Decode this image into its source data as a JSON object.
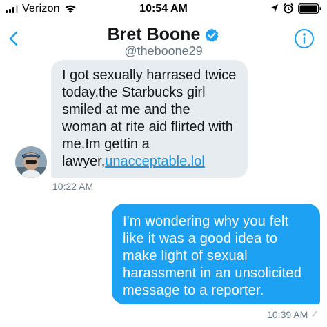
{
  "status_bar": {
    "carrier": "Verizon",
    "time": "10:54 AM"
  },
  "header": {
    "name": "Bret Boone",
    "handle": "@theboone29"
  },
  "messages": [
    {
      "direction": "incoming",
      "text": "I got sexually harrased twice today.the Starbucks girl smiled at me and the woman at rite aid flirted with me.Im gettin a lawyer,",
      "link_text": "unacceptable.lol",
      "time": "10:22 AM"
    },
    {
      "direction": "outgoing",
      "text": "I'm wondering why you felt like it was a good idea to make light of sexual harassment in an unsolicited message to a reporter.",
      "time": "10:39 AM",
      "status_mark": "✓"
    }
  ],
  "colors": {
    "accent": "#1da1f2",
    "incoming_bubble": "#e6ecf0",
    "link": "#1b95e0",
    "muted": "#657786"
  },
  "icons": [
    "signal-icon",
    "wifi-icon",
    "location-icon",
    "alarm-icon",
    "battery-icon",
    "back-chevron-icon",
    "verified-badge-icon",
    "info-icon",
    "avatar"
  ]
}
